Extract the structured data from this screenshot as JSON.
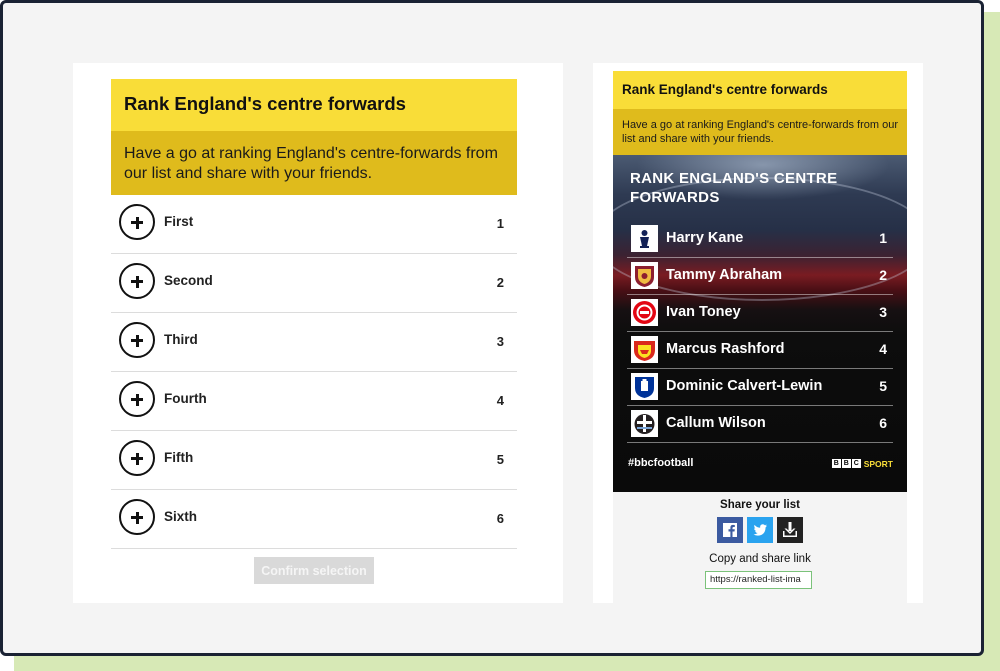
{
  "left_panel": {
    "title": "Rank England's centre forwards",
    "subtitle": "Have a go at ranking England's centre-forwards from our list and share with your friends.",
    "rows": [
      {
        "label": "First",
        "number": "1"
      },
      {
        "label": "Second",
        "number": "2"
      },
      {
        "label": "Third",
        "number": "3"
      },
      {
        "label": "Fourth",
        "number": "4"
      },
      {
        "label": "Fifth",
        "number": "5"
      },
      {
        "label": "Sixth",
        "number": "6"
      }
    ],
    "confirm_label": "Confirm selection"
  },
  "right_panel": {
    "title": "Rank England's centre forwards",
    "subtitle": "Have a go at ranking England's centre-forwards from our list and share with your friends.",
    "card": {
      "heading": "RANK ENGLAND'S CENTRE FORWARDS",
      "players": [
        {
          "name": "Harry Kane",
          "rank": "1",
          "badge": "tottenham-crest-icon"
        },
        {
          "name": "Tammy Abraham",
          "rank": "2",
          "badge": "roma-crest-icon"
        },
        {
          "name": "Ivan Toney",
          "rank": "3",
          "badge": "brentford-crest-icon"
        },
        {
          "name": "Marcus Rashford",
          "rank": "4",
          "badge": "man-utd-crest-icon"
        },
        {
          "name": "Dominic Calvert-Lewin",
          "rank": "5",
          "badge": "everton-crest-icon"
        },
        {
          "name": "Callum Wilson",
          "rank": "6",
          "badge": "newcastle-crest-icon"
        }
      ],
      "hashtag": "#bbcfootball",
      "brand_letters": [
        "B",
        "B",
        "C"
      ],
      "brand_word": "SPORT"
    },
    "share": {
      "title": "Share your list",
      "copy_label": "Copy and share link",
      "link_value": "https://ranked-list-ima"
    }
  },
  "colors": {
    "yellow": "#f9dd38",
    "dark_yellow": "#dfbb1c",
    "facebook": "#3b5aa0",
    "twitter": "#2aa3ef"
  }
}
